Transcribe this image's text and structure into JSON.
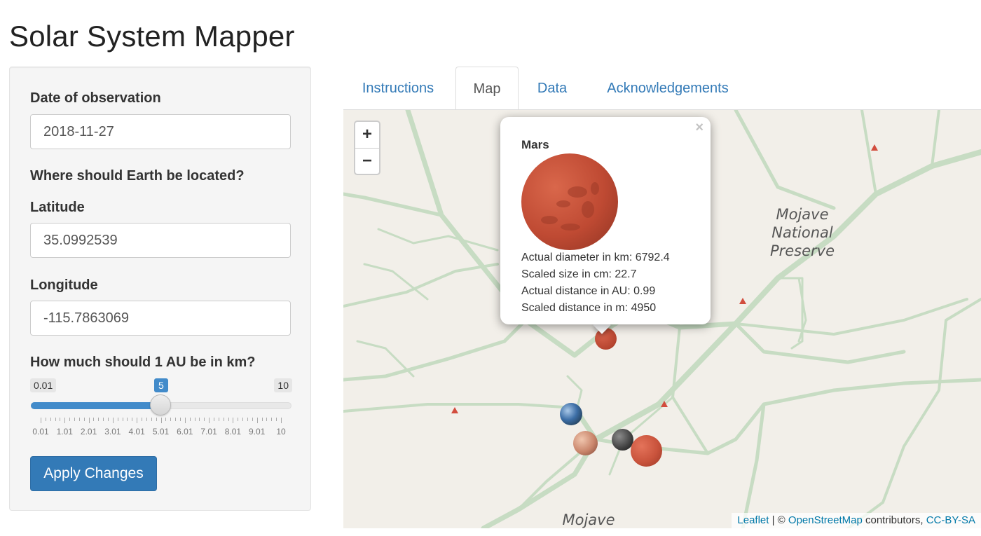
{
  "app": {
    "title": "Solar System Mapper"
  },
  "sidebar": {
    "date_label": "Date of observation",
    "date_value": "2018-11-27",
    "earth_heading": "Where should Earth be located?",
    "lat_label": "Latitude",
    "lat_value": "35.0992539",
    "lon_label": "Longitude",
    "lon_value": "-115.7863069",
    "au_label": "How much should 1 AU be in km?",
    "slider": {
      "min_label": "0.01",
      "max_label": "10",
      "value_label": "5",
      "value": 5,
      "min": 0.01,
      "max": 10,
      "tick_labels": [
        "0.01",
        "1.01",
        "2.01",
        "3.01",
        "4.01",
        "5.01",
        "6.01",
        "7.01",
        "8.01",
        "9.01",
        "10"
      ]
    },
    "apply_label": "Apply Changes"
  },
  "tabs": [
    {
      "label": "Instructions",
      "active": false
    },
    {
      "label": "Map",
      "active": true
    },
    {
      "label": "Data",
      "active": false
    },
    {
      "label": "Acknowledgements",
      "active": false
    }
  ],
  "map": {
    "zoom_in": "+",
    "zoom_out": "−",
    "place_preserve": "Mojave National Preserve",
    "place_mojave": "Mojave",
    "popup": {
      "close": "×",
      "name": "Mars",
      "lines": [
        "Actual diameter in km: 6792.4",
        "Scaled size in cm: 22.7",
        "Actual distance in AU: 0.99",
        "Scaled distance in m: 4950"
      ]
    },
    "attribution": {
      "leaflet": "Leaflet",
      "sep": " | © ",
      "osm": "OpenStreetMap",
      "contrib": " contributors, ",
      "license": "CC-BY-SA"
    },
    "colors": {
      "road": "#c7dcc3",
      "land": "#f2efe9",
      "mars": "#c65037",
      "peak": "#d24d3e"
    }
  }
}
